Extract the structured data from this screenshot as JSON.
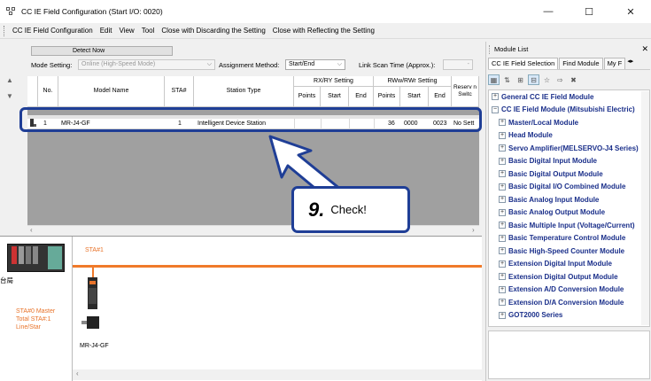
{
  "window": {
    "title": "CC IE Field Configuration (Start I/O: 0020)",
    "minimize": "—",
    "maximize": "☐",
    "close": "✕"
  },
  "menu": {
    "items": [
      "CC IE Field Configuration",
      "Edit",
      "View",
      "Tool",
      "Close with Discarding the Setting",
      "Close with Reflecting the Setting"
    ]
  },
  "settings": {
    "detect_now": "Detect Now",
    "mode_label": "Mode Setting:",
    "mode_value": "Online (High-Speed Mode)",
    "assignment_label": "Assignment Method:",
    "assignment_value": "Start/End",
    "link_scan_label": "Link Scan Time (Approx.):",
    "link_scan_value": "-"
  },
  "table": {
    "headers": {
      "no": "No.",
      "model": "Model Name",
      "sta": "STA#",
      "station_type": "Station Type",
      "rxry": "RX/RY Setting",
      "rww": "RWw/RWr Setting",
      "reserve": "Reserve/Error Invalid Station",
      "reserve_short": "Reserv n Switc",
      "points": "Points",
      "start": "Start",
      "end": "End"
    },
    "rows": [
      {
        "no": "1",
        "model": "MR-J4-GF",
        "sta": "1",
        "station_type": "Intelligent Device Station",
        "rx_points": "",
        "rx_start": "",
        "rx_end": "",
        "rw_points": "36",
        "rw_start": "0000",
        "rw_end": "0023",
        "reserve": "No Sett"
      }
    ]
  },
  "network": {
    "sta_label": "STA#1",
    "host_label": "台局",
    "master_lines": [
      "STA#0  Master",
      "Total STA#:1",
      "Line/Star"
    ],
    "device_label": "MR-J4-GF"
  },
  "callout": {
    "number": "9.",
    "text": "Check!"
  },
  "module_list": {
    "title": "Module List",
    "tabs": [
      "CC IE Field Selection",
      "Find Module",
      "My F"
    ],
    "tree": [
      {
        "label": "General CC IE Field Module",
        "level": 0
      },
      {
        "label": "CC IE Field Module (Mitsubishi Electric)",
        "level": 0,
        "expanded": true
      },
      {
        "label": "Master/Local Module",
        "level": 1
      },
      {
        "label": "Head Module",
        "level": 1
      },
      {
        "label": "Servo Amplifier(MELSERVO-J4 Series)",
        "level": 1
      },
      {
        "label": "Basic Digital Input Module",
        "level": 1
      },
      {
        "label": "Basic Digital Output Module",
        "level": 1
      },
      {
        "label": "Basic Digital I/O Combined Module",
        "level": 1
      },
      {
        "label": "Basic Analog Input Module",
        "level": 1
      },
      {
        "label": "Basic Analog Output Module",
        "level": 1
      },
      {
        "label": "Basic Multiple Input (Voltage/Current)",
        "level": 1
      },
      {
        "label": "Basic Temperature Control Module",
        "level": 1
      },
      {
        "label": "Basic High-Speed Counter Module",
        "level": 1
      },
      {
        "label": "Extension Digital Input Module",
        "level": 1
      },
      {
        "label": "Extension Digital Output Module",
        "level": 1
      },
      {
        "label": "Extension A/D Conversion Module",
        "level": 1
      },
      {
        "label": "Extension D/A Conversion Module",
        "level": 1
      },
      {
        "label": "GOT2000 Series",
        "level": 1
      }
    ]
  },
  "colors": {
    "accent_blue": "#1f3e96",
    "network_orange": "#f07a2a",
    "tree_text": "#1a2f8a"
  }
}
